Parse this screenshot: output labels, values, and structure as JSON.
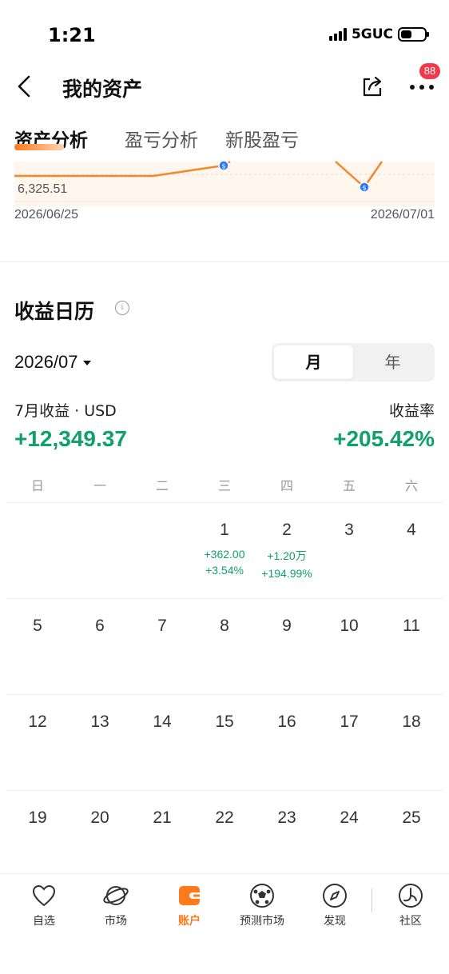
{
  "status_bar": {
    "time": "1:21",
    "network": "5GUC"
  },
  "header": {
    "title": "我的资产",
    "badge": "88"
  },
  "analysis_tabs": [
    {
      "label": "资产分析",
      "active": true
    },
    {
      "label": "盈亏分析",
      "active": false
    },
    {
      "label": "新股盈亏",
      "active": false
    }
  ],
  "chart_data": {
    "type": "line",
    "min_label": "6,325.51",
    "x_start": "2026/06/25",
    "x_end": "2026/07/01",
    "line_color": "#f08a2e",
    "marker_color": "#2f7bf6"
  },
  "calendar": {
    "title": "收益日历",
    "month": "2026/07",
    "segments": [
      {
        "label": "月",
        "active": true
      },
      {
        "label": "年",
        "active": false
      }
    ],
    "income_label": "7月收益 · USD",
    "income_value": "+12,349.37",
    "rate_label": "收益率",
    "rate_value": "+205.42%",
    "positive_color": "#10a06a",
    "weekdays": [
      "日",
      "一",
      "二",
      "三",
      "四",
      "五",
      "六"
    ],
    "weeks": [
      [
        {
          "day": "",
          "pnl": "",
          "pct": ""
        },
        {
          "day": "",
          "pnl": "",
          "pct": ""
        },
        {
          "day": "",
          "pnl": "",
          "pct": ""
        },
        {
          "day": "1",
          "pnl": "+362.00",
          "pct": "+3.54%"
        },
        {
          "day": "2",
          "pnl": "+1.20万",
          "pct": "+194.99%"
        },
        {
          "day": "3",
          "pnl": "",
          "pct": ""
        },
        {
          "day": "4",
          "pnl": "",
          "pct": ""
        }
      ],
      [
        {
          "day": "5",
          "pnl": "",
          "pct": ""
        },
        {
          "day": "6",
          "pnl": "",
          "pct": ""
        },
        {
          "day": "7",
          "pnl": "",
          "pct": ""
        },
        {
          "day": "8",
          "pnl": "",
          "pct": ""
        },
        {
          "day": "9",
          "pnl": "",
          "pct": ""
        },
        {
          "day": "10",
          "pnl": "",
          "pct": ""
        },
        {
          "day": "11",
          "pnl": "",
          "pct": ""
        }
      ],
      [
        {
          "day": "12",
          "pnl": "",
          "pct": ""
        },
        {
          "day": "13",
          "pnl": "",
          "pct": ""
        },
        {
          "day": "14",
          "pnl": "",
          "pct": ""
        },
        {
          "day": "15",
          "pnl": "",
          "pct": ""
        },
        {
          "day": "16",
          "pnl": "",
          "pct": ""
        },
        {
          "day": "17",
          "pnl": "",
          "pct": ""
        },
        {
          "day": "18",
          "pnl": "",
          "pct": ""
        }
      ],
      [
        {
          "day": "19",
          "pnl": "",
          "pct": ""
        },
        {
          "day": "20",
          "pnl": "",
          "pct": ""
        },
        {
          "day": "21",
          "pnl": "",
          "pct": ""
        },
        {
          "day": "22",
          "pnl": "",
          "pct": ""
        },
        {
          "day": "23",
          "pnl": "",
          "pct": ""
        },
        {
          "day": "24",
          "pnl": "",
          "pct": ""
        },
        {
          "day": "25",
          "pnl": "",
          "pct": ""
        }
      ]
    ]
  },
  "bottom_nav": [
    {
      "label": "自选",
      "icon": "heart-icon",
      "active": false
    },
    {
      "label": "市场",
      "icon": "planet-icon",
      "active": false
    },
    {
      "label": "账户",
      "icon": "wallet-icon",
      "active": true
    },
    {
      "label": "预测市场",
      "icon": "soccer-ball-icon",
      "active": false
    },
    {
      "label": "发现",
      "icon": "compass-icon",
      "active": false
    },
    {
      "label": "社区",
      "icon": "community-icon",
      "active": false
    }
  ],
  "accent_color": "#ff7a1a"
}
